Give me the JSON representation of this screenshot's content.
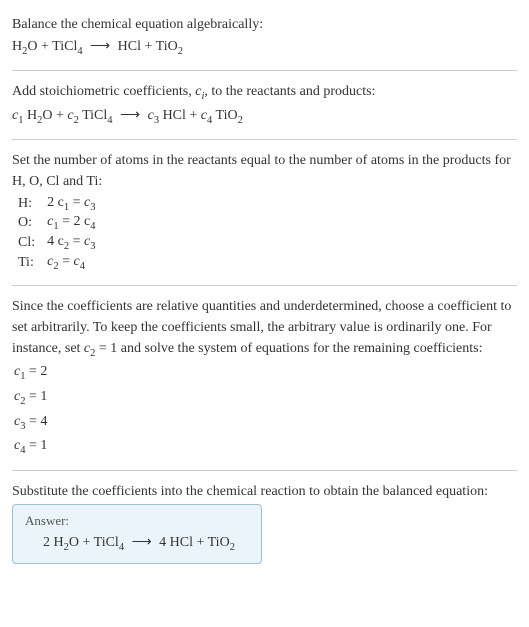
{
  "intro": {
    "title": "Balance the chemical equation algebraically:"
  },
  "reaction": {
    "r1": "H",
    "r1_sub": "2",
    "r1b": "O",
    "plus1": " + ",
    "r2": "TiCl",
    "r2_sub": "4",
    "arrow": "⟶",
    "p1": "HCl",
    "plus2": " + ",
    "p2": "TiO",
    "p2_sub": "2"
  },
  "stoich": {
    "text_a": "Add stoichiometric coefficients, ",
    "ci_c": "c",
    "ci_i": "i",
    "text_b": ", to the reactants and products:"
  },
  "stoich_eq": {
    "c1": "c",
    "c1s": "1",
    "sp1": " H",
    "sp1s": "2",
    "sp1b": "O + ",
    "c2": "c",
    "c2s": "2",
    "sp2": " TiCl",
    "sp2s": "4",
    "arrow": "⟶",
    "c3": "c",
    "c3s": "3",
    "sp3": " HCl + ",
    "c4": "c",
    "c4s": "4",
    "sp4": " TiO",
    "sp4s": "2"
  },
  "atoms": {
    "text": "Set the number of atoms in the reactants equal to the number of atoms in the products for H, O, Cl and Ti:"
  },
  "eqs": [
    {
      "el": "H:",
      "lhs_c": "2 c",
      "lhs_s": "1",
      "mid": " = ",
      "rhs_c": "c",
      "rhs_s": "3",
      "rhs_tail": ""
    },
    {
      "el": "O:",
      "lhs_c": "c",
      "lhs_s": "1",
      "mid": " = ",
      "rhs_c": "2 c",
      "rhs_s": "4",
      "rhs_tail": ""
    },
    {
      "el": "Cl:",
      "lhs_c": "4 c",
      "lhs_s": "2",
      "mid": " = ",
      "rhs_c": "c",
      "rhs_s": "3",
      "rhs_tail": ""
    },
    {
      "el": "Ti:",
      "lhs_c": "c",
      "lhs_s": "2",
      "mid": " = ",
      "rhs_c": "c",
      "rhs_s": "4",
      "rhs_tail": ""
    }
  ],
  "choose": {
    "text_a": "Since the coefficients are relative quantities and underdetermined, choose a coefficient to set arbitrarily. To keep the coefficients small, the arbitrary value is ordinarily one. For instance, set ",
    "c": "c",
    "cs": "2",
    "text_b": " = 1 and solve the system of equations for the remaining coefficients:"
  },
  "results": [
    {
      "c": "c",
      "s": "1",
      "eq": " = 2"
    },
    {
      "c": "c",
      "s": "2",
      "eq": " = 1"
    },
    {
      "c": "c",
      "s": "3",
      "eq": " = 4"
    },
    {
      "c": "c",
      "s": "4",
      "eq": " = 1"
    }
  ],
  "subst": {
    "text": "Substitute the coefficients into the chemical reaction to obtain the balanced equation:"
  },
  "answer": {
    "label": "Answer:",
    "a1": "2 H",
    "a1s": "2",
    "a1b": "O + TiCl",
    "a1c": "4",
    "arrow": "⟶",
    "a2": " 4 HCl + TiO",
    "a2s": "2"
  }
}
